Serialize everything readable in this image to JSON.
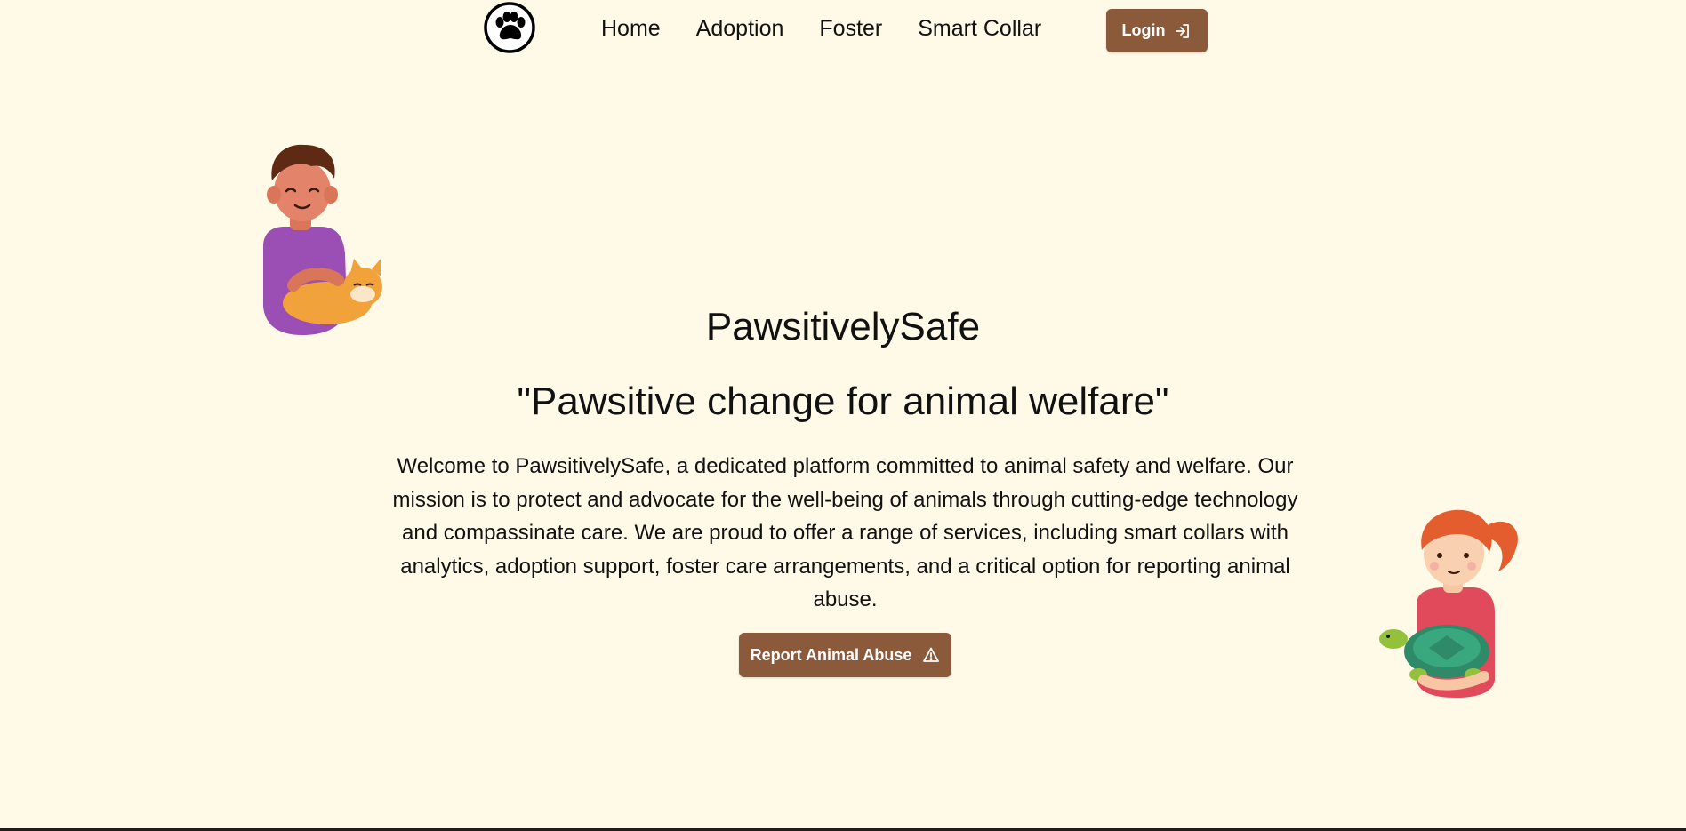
{
  "brand": {
    "logo_icon": "paw-icon"
  },
  "nav": {
    "items": [
      {
        "label": "Home"
      },
      {
        "label": "Adoption"
      },
      {
        "label": "Foster"
      },
      {
        "label": "Smart Collar"
      }
    ],
    "login_label": "Login",
    "login_icon": "sign-in-icon"
  },
  "hero": {
    "title": "PawsitivelySafe",
    "tagline": "\"Pawsitive change for animal welfare\"",
    "description": "Welcome to PawsitivelySafe, a dedicated platform committed to animal safety and welfare. Our mission is to protect and advocate for the well-being of animals through cutting-edge technology and compassinate care. We are proud to offer a range of services, including smart collars with analytics, adoption support, foster care arrangements, and a critical option for reporting animal abuse.",
    "report_label": "Report Animal Abuse",
    "report_icon": "warning-icon"
  },
  "colors": {
    "background": "#fffae8",
    "button": "#8b5a3a",
    "text": "#111111"
  }
}
